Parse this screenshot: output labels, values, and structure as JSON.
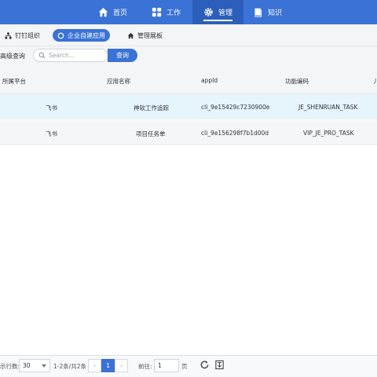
{
  "nav": {
    "items": [
      {
        "label": "首页",
        "icon": "home-icon"
      },
      {
        "label": "工作",
        "icon": "grid-icon"
      },
      {
        "label": "管理",
        "icon": "gear-icon",
        "active": true
      },
      {
        "label": "知识",
        "icon": "book-icon"
      }
    ]
  },
  "subtabs": [
    {
      "label": "钉钉组织",
      "icon": "org-icon"
    },
    {
      "label": "企业自建应用",
      "icon": "circle-icon",
      "active": true
    },
    {
      "label": "管理展板",
      "icon": "house-icon"
    }
  ],
  "search": {
    "adv_label": "高级查询",
    "placeholder": "Search...",
    "button_label": "查询"
  },
  "table": {
    "headers": [
      "所属平台",
      "应用名称",
      "appId",
      "功能编码",
      "丿"
    ],
    "rows": [
      {
        "platform": "飞书",
        "name": "神软工作追踪",
        "appid": "cli_9e15429c7230900e",
        "code": "JE_SHENRUAN_TASK"
      },
      {
        "platform": "飞书",
        "name": "项目任务单",
        "appid": "cli_9e156298f7b1d00d",
        "code": "VIP_JE_PRO_TASK"
      }
    ]
  },
  "pager": {
    "rows_label": "示行数:",
    "page_size": "30",
    "range_text": "1-2条/共2条",
    "current_page": "1",
    "goto_label": "前往:",
    "goto_value": "1",
    "page_unit": "页",
    "prev": "‹",
    "next": "›"
  },
  "colors": {
    "accent": "#3a72d6",
    "selected_row": "#e6f4fc"
  }
}
